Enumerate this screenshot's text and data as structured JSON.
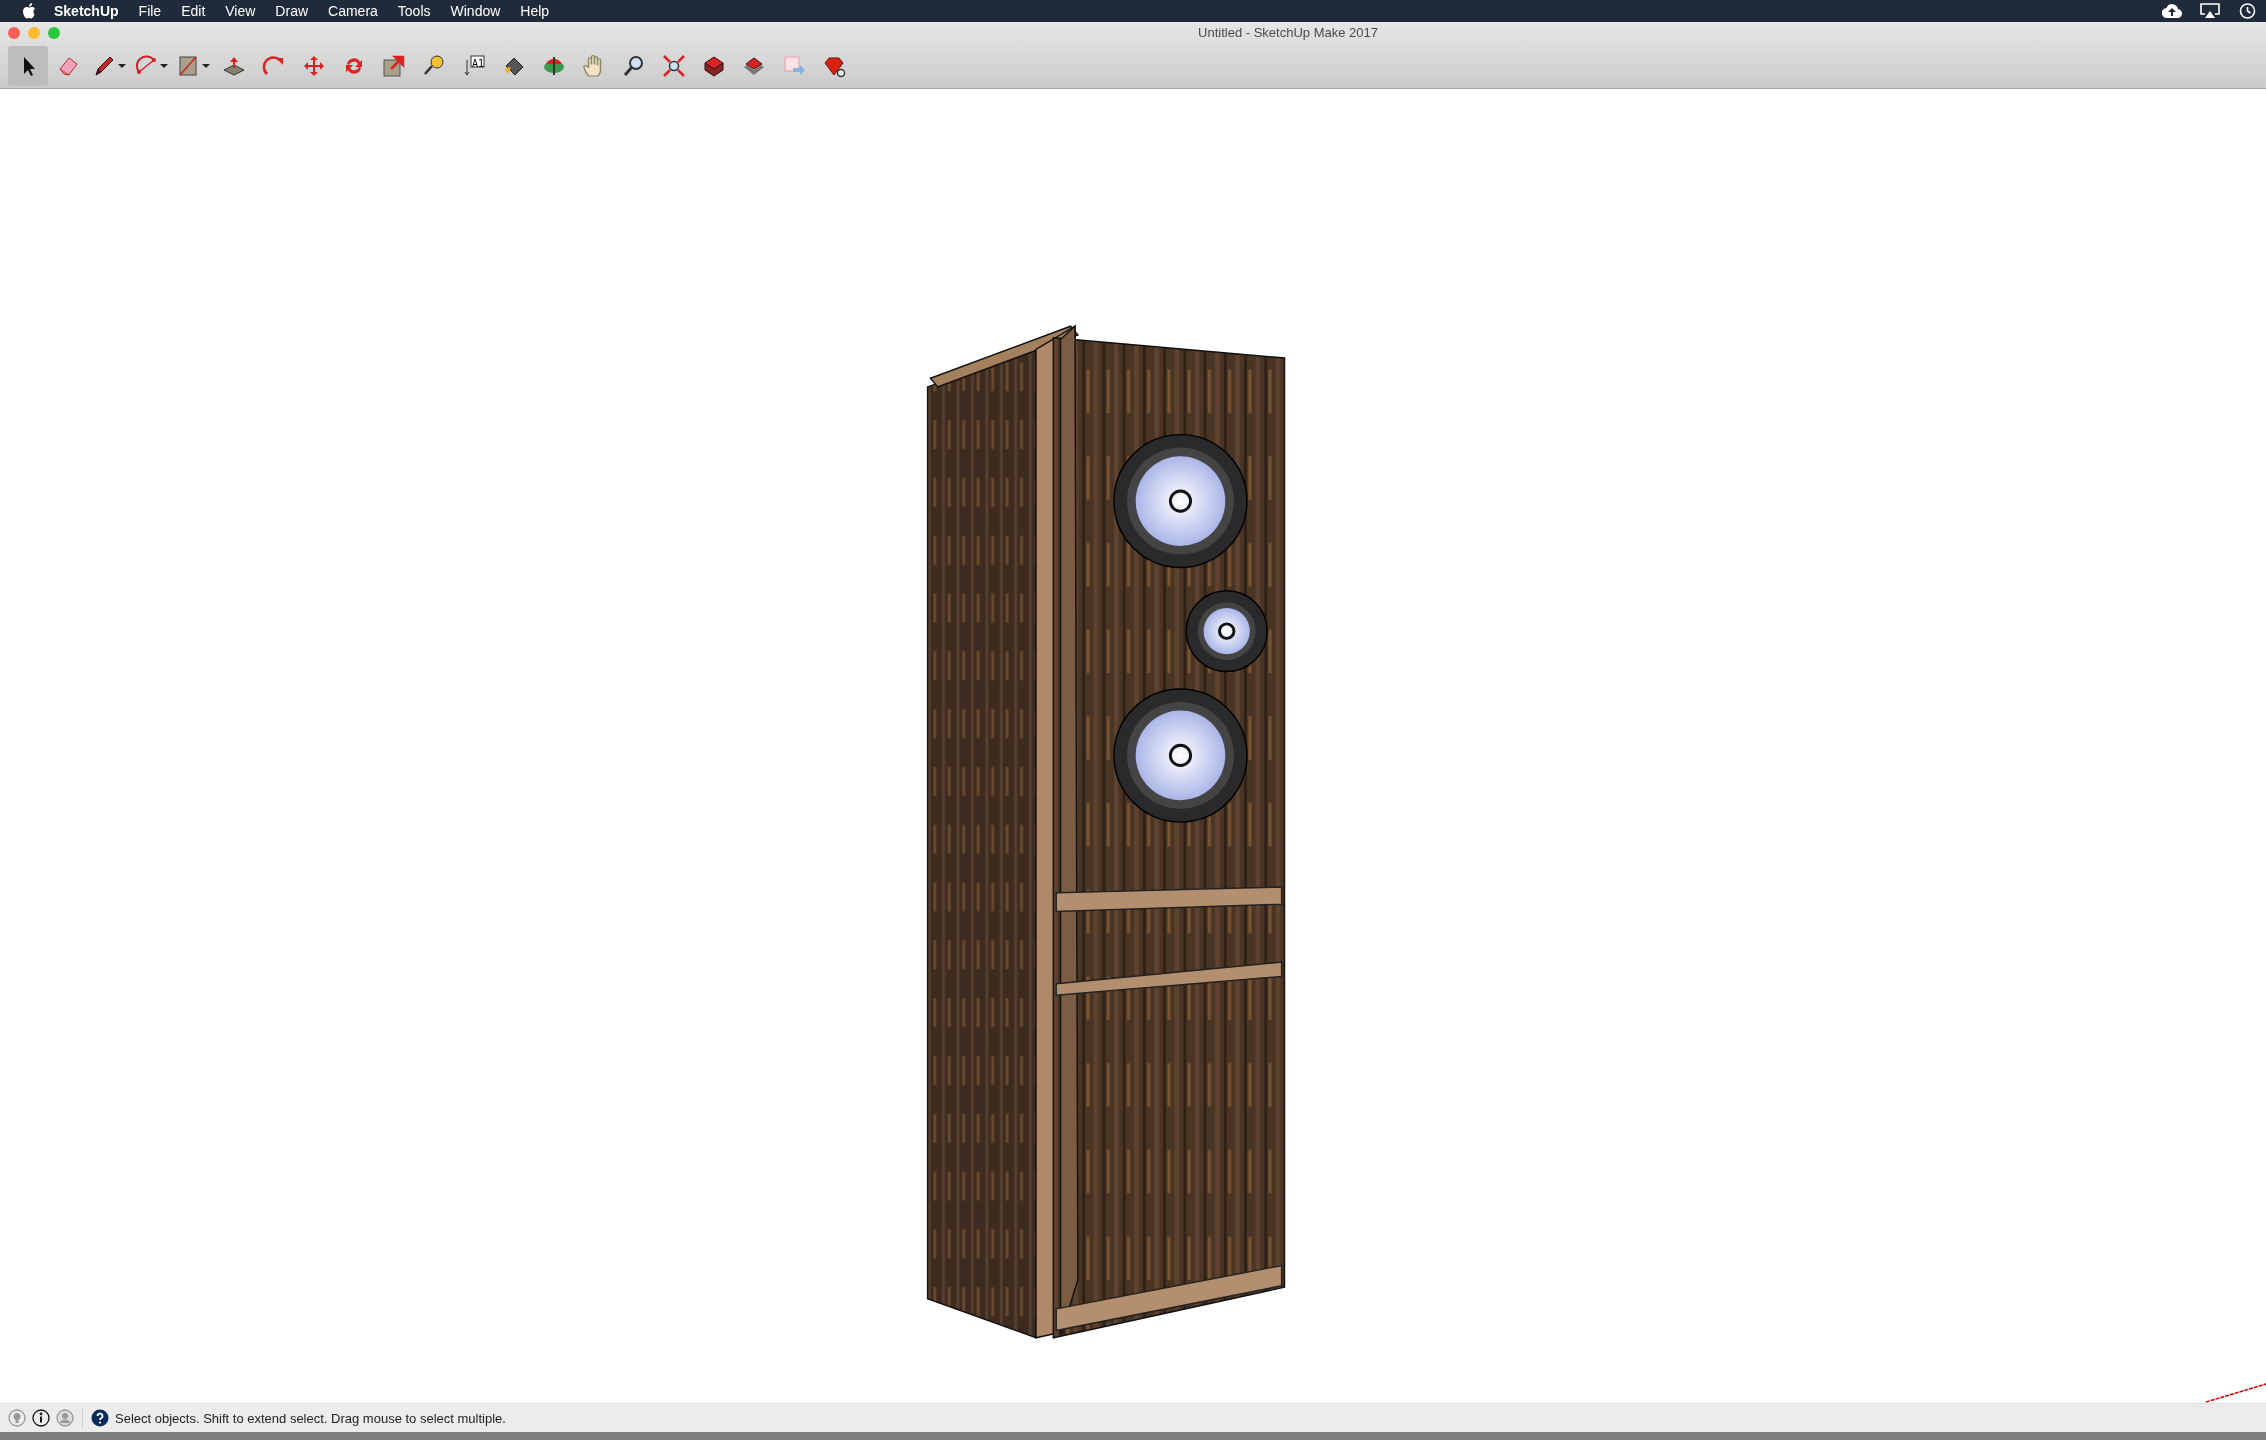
{
  "menu_bar": {
    "app_name": "SketchUp",
    "items": [
      "File",
      "Edit",
      "View",
      "Draw",
      "Camera",
      "Tools",
      "Window",
      "Help"
    ]
  },
  "window": {
    "title": "Untitled - SketchUp Make 2017"
  },
  "toolbar": [
    {
      "kind": "select",
      "selected": true,
      "dropdown": false
    },
    {
      "kind": "eraser",
      "selected": false,
      "dropdown": false
    },
    {
      "kind": "pencil",
      "selected": false,
      "dropdown": true
    },
    {
      "kind": "arc",
      "selected": false,
      "dropdown": true
    },
    {
      "kind": "rectangle",
      "selected": false,
      "dropdown": true
    },
    {
      "kind": "pushpull",
      "selected": false,
      "dropdown": false
    },
    {
      "kind": "followme",
      "selected": false,
      "dropdown": false
    },
    {
      "kind": "move",
      "selected": false,
      "dropdown": false
    },
    {
      "kind": "rotate",
      "selected": false,
      "dropdown": false
    },
    {
      "kind": "scale",
      "selected": false,
      "dropdown": false
    },
    {
      "kind": "tape",
      "selected": false,
      "dropdown": false
    },
    {
      "kind": "text",
      "selected": false,
      "dropdown": false,
      "label": "A1"
    },
    {
      "kind": "paint",
      "selected": false,
      "dropdown": false
    },
    {
      "kind": "orbit",
      "selected": false,
      "dropdown": false
    },
    {
      "kind": "pan",
      "selected": false,
      "dropdown": false
    },
    {
      "kind": "zoom",
      "selected": false,
      "dropdown": false
    },
    {
      "kind": "extents",
      "selected": false,
      "dropdown": false
    },
    {
      "kind": "warehouse",
      "selected": false,
      "dropdown": false
    },
    {
      "kind": "extwarehouse",
      "selected": false,
      "dropdown": false
    },
    {
      "kind": "layout",
      "selected": false,
      "dropdown": false
    },
    {
      "kind": "ruby",
      "selected": false,
      "dropdown": false
    }
  ],
  "status_bar": {
    "message": "Select objects. Shift to extend select. Drag mouse to select multiple."
  }
}
